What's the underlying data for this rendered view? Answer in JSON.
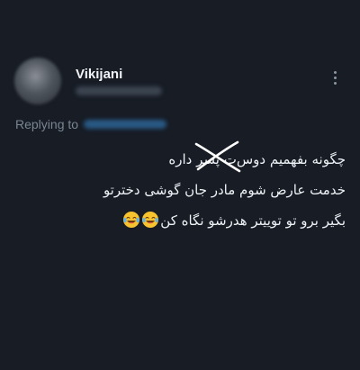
{
  "tweet": {
    "author_name": "Vikijani",
    "reply_label": "Replying to",
    "lines": {
      "line1_before": "چگونه بفهمیم دوس",
      "line1_struck": "ت پسر",
      "line1_after": " داره",
      "line2": "خدمت عارض شوم مادر جان گوشی دخترتو",
      "line3": "بگیر برو تو توییتر هدرشو نگاه کن"
    },
    "emoji_name": "face-with-tears-of-joy-icon",
    "emoji_count": 2
  },
  "colors": {
    "background": "#171c25",
    "text": "#eef1f5",
    "muted": "#7a8592",
    "mention": "#2e6da4",
    "scribble": "#ffffff"
  }
}
